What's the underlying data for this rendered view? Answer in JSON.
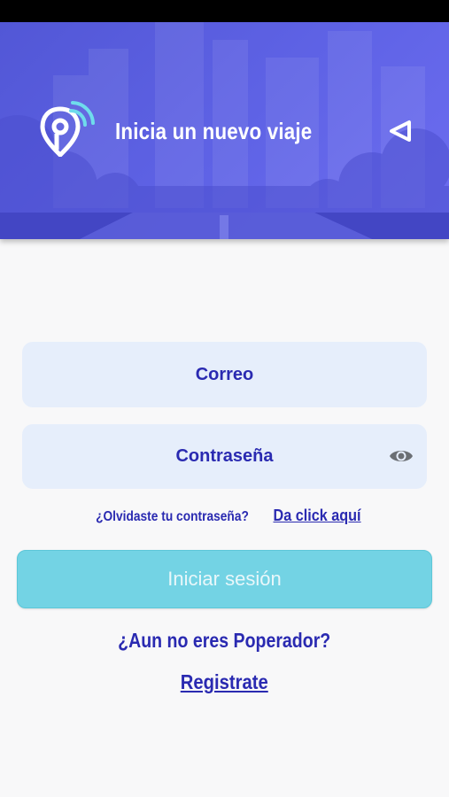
{
  "header": {
    "title": "Inicia un nuevo viaje",
    "logo_icon": "location-pin-signal-icon",
    "back_icon": "back-triangle-icon"
  },
  "form": {
    "email_placeholder": "Correo",
    "password_placeholder": "Contraseña",
    "password_toggle_icon": "eye-icon"
  },
  "forgot": {
    "question": "¿Olvidaste tu contraseña?",
    "link": "Da click aquí"
  },
  "login_button_label": "Iniciar sesión",
  "signup": {
    "question": "¿Aun no eres Poperador?",
    "link": "Registrate"
  },
  "colors": {
    "header": "#5f63e6",
    "brand_text": "#2a2ab1",
    "field_bg": "#e6eefb",
    "button": "#73d3e4"
  }
}
